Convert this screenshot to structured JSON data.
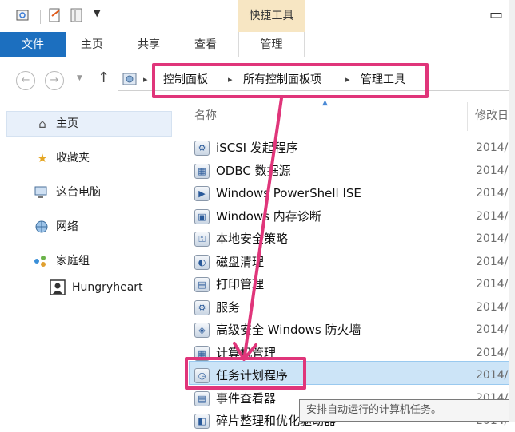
{
  "ribbon": {
    "contextual_group": "快捷工具",
    "tabs": [
      "文件",
      "主页",
      "共享",
      "查看",
      "管理"
    ]
  },
  "address": {
    "crumbs": [
      "控制面板",
      "所有控制面板项",
      "管理工具"
    ]
  },
  "nav": {
    "items": [
      "主页",
      "收藏夹",
      "这台电脑",
      "网络",
      "家庭组",
      "Hungryheart"
    ]
  },
  "list": {
    "col_name": "名称",
    "col_date": "修改日",
    "rows": [
      {
        "name": "iSCSI 发起程序",
        "date": "2014/"
      },
      {
        "name": "ODBC 数据源",
        "date": "2014/"
      },
      {
        "name": "Windows PowerShell ISE",
        "date": "2014/"
      },
      {
        "name": "Windows 内存诊断",
        "date": "2014/"
      },
      {
        "name": "本地安全策略",
        "date": "2014/"
      },
      {
        "name": "磁盘清理",
        "date": "2014/"
      },
      {
        "name": "打印管理",
        "date": "2014/"
      },
      {
        "name": "服务",
        "date": "2014/"
      },
      {
        "name": "高级安全 Windows 防火墙",
        "date": "2014/"
      },
      {
        "name": "计算机管理",
        "date": "2014/"
      },
      {
        "name": "任务计划程序",
        "date": "2014/"
      },
      {
        "name": "事件查看器",
        "date": "2014/"
      },
      {
        "name": "碎片整理和优化驱动器",
        "date": "2014/"
      }
    ]
  },
  "tooltip": "安排自动运行的计算机任务。",
  "colors": {
    "accent": "#1c6fbf",
    "annotation": "#e0357a",
    "selection": "#cce4f7"
  }
}
